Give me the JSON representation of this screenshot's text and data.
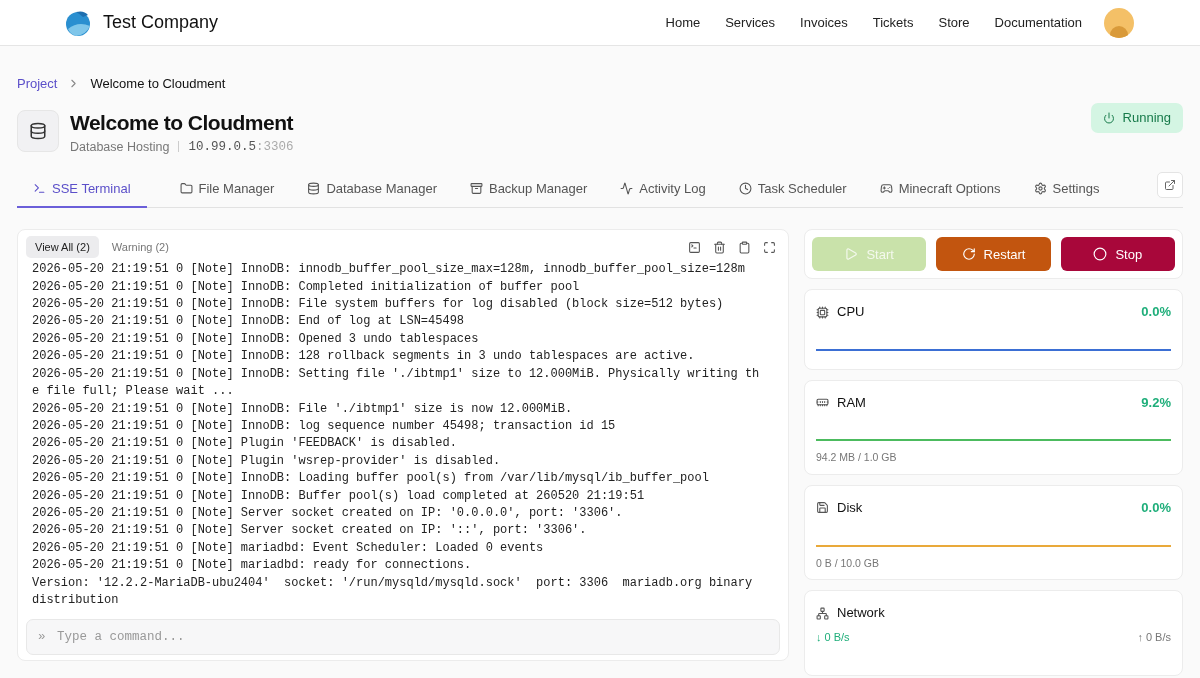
{
  "header": {
    "company": "Test Company",
    "nav": [
      "Home",
      "Services",
      "Invoices",
      "Tickets",
      "Store",
      "Documentation"
    ]
  },
  "breadcrumb": {
    "parent": "Project",
    "current": "Welcome to Cloudment"
  },
  "server": {
    "title": "Welcome to Cloudment",
    "type": "Database Hosting",
    "ip": "10.99.0.5",
    "port": ":3306",
    "status": "Running"
  },
  "tabs": [
    {
      "label": "SSE Terminal",
      "selected": true
    },
    {
      "label": "File Manager",
      "selected": false
    },
    {
      "label": "Database Manager",
      "selected": false
    },
    {
      "label": "Backup Manager",
      "selected": false
    },
    {
      "label": "Activity Log",
      "selected": false
    },
    {
      "label": "Task Scheduler",
      "selected": false
    },
    {
      "label": "Minecraft Options",
      "selected": false
    },
    {
      "label": "Settings",
      "selected": false
    }
  ],
  "terminal": {
    "filters": [
      {
        "label": "View All (2)",
        "selected": true
      },
      {
        "label": "Warning (2)",
        "selected": false
      }
    ],
    "lines": [
      "2026-05-20 21:19:51 0 [Note] InnoDB: innodb_buffer_pool_size_max=128m, innodb_buffer_pool_size=128m",
      "2026-05-20 21:19:51 0 [Note] InnoDB: Completed initialization of buffer pool",
      "2026-05-20 21:19:51 0 [Note] InnoDB: File system buffers for log disabled (block size=512 bytes)",
      "2026-05-20 21:19:51 0 [Note] InnoDB: End of log at LSN=45498",
      "2026-05-20 21:19:51 0 [Note] InnoDB: Opened 3 undo tablespaces",
      "2026-05-20 21:19:51 0 [Note] InnoDB: 128 rollback segments in 3 undo tablespaces are active.",
      "2026-05-20 21:19:51 0 [Note] InnoDB: Setting file './ibtmp1' size to 12.000MiB. Physically writing the file full; Please wait ...",
      "2026-05-20 21:19:51 0 [Note] InnoDB: File './ibtmp1' size is now 12.000MiB.",
      "2026-05-20 21:19:51 0 [Note] InnoDB: log sequence number 45498; transaction id 15",
      "2026-05-20 21:19:51 0 [Note] Plugin 'FEEDBACK' is disabled.",
      "2026-05-20 21:19:51 0 [Note] Plugin 'wsrep-provider' is disabled.",
      "2026-05-20 21:19:51 0 [Note] InnoDB: Loading buffer pool(s) from /var/lib/mysql/ib_buffer_pool",
      "2026-05-20 21:19:51 0 [Note] InnoDB: Buffer pool(s) load completed at 260520 21:19:51",
      "2026-05-20 21:19:51 0 [Note] Server socket created on IP: '0.0.0.0', port: '3306'.",
      "2026-05-20 21:19:51 0 [Note] Server socket created on IP: '::', port: '3306'.",
      "2026-05-20 21:19:51 0 [Note] mariadbd: Event Scheduler: Loaded 0 events",
      "2026-05-20 21:19:51 0 [Note] mariadbd: ready for connections.",
      "Version: '12.2.2-MariaDB-ubu2404'  socket: '/run/mysqld/mysqld.sock'  port: 3306  mariadb.org binary distribution"
    ],
    "input": {
      "prompt": "»",
      "placeholder": "Type a command..."
    }
  },
  "controls": [
    {
      "label": "Start",
      "kind": "start",
      "disabled": true
    },
    {
      "label": "Restart",
      "kind": "restart",
      "disabled": false
    },
    {
      "label": "Stop",
      "kind": "stop",
      "disabled": false
    }
  ],
  "metrics": [
    {
      "kind": "cpu",
      "label": "CPU",
      "value": "0.0%",
      "color": "#3b6fd4"
    },
    {
      "kind": "ram",
      "label": "RAM",
      "value": "9.2%",
      "color": "#4cbb5e",
      "detail": "94.2 MB / 1.0 GB"
    },
    {
      "kind": "disk",
      "label": "Disk",
      "value": "0.0%",
      "color": "#e9a93a",
      "detail": "0 B / 10.0 GB"
    },
    {
      "kind": "network",
      "label": "Network",
      "down": "↓ 0 B/s",
      "up": "↑ 0 B/s"
    }
  ]
}
